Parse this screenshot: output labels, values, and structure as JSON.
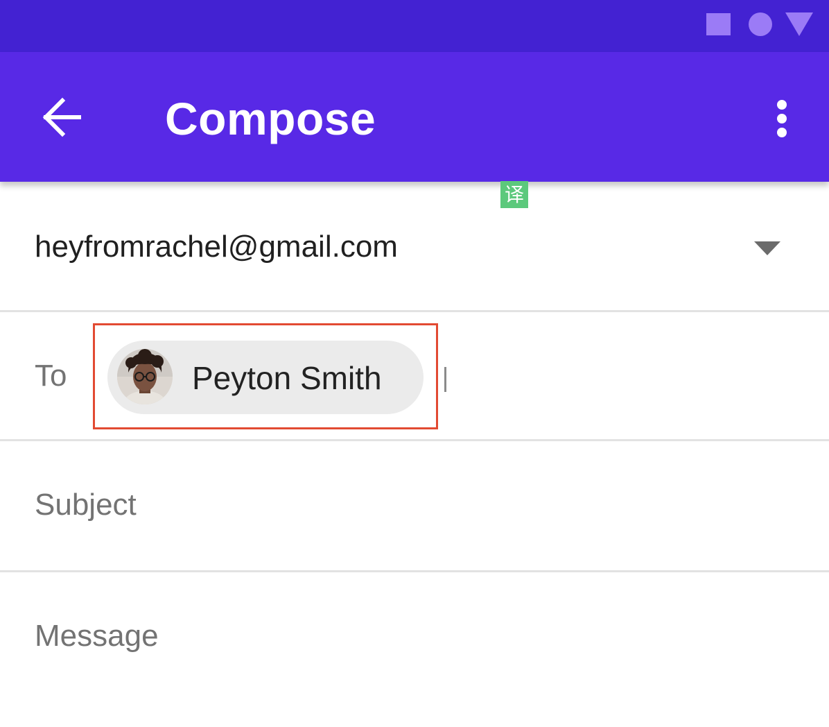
{
  "colors": {
    "status_bar": "#4322d2",
    "app_bar": "#5829e6",
    "status_icons": "#9b7bf6",
    "highlight": "#e24a32",
    "chip_background": "#ebebeb",
    "translate_badge": "#5cc97c"
  },
  "status_bar": {
    "icons": [
      "stop-square-icon",
      "home-circle-icon",
      "back-triangle-icon"
    ]
  },
  "app_bar": {
    "title": "Compose",
    "back_icon": "arrow-back-icon",
    "overflow_icon": "more-vert-icon"
  },
  "translate_badge": {
    "label": "译"
  },
  "compose": {
    "from": {
      "value": "heyfromrachel@gmail.com",
      "dropdown_icon": "arrow-drop-down-icon"
    },
    "to": {
      "label": "To",
      "recipients": [
        {
          "name": "Peyton Smith",
          "avatar_icon": "person-avatar"
        }
      ]
    },
    "subject": {
      "placeholder": "Subject"
    },
    "message": {
      "placeholder": "Message"
    }
  }
}
